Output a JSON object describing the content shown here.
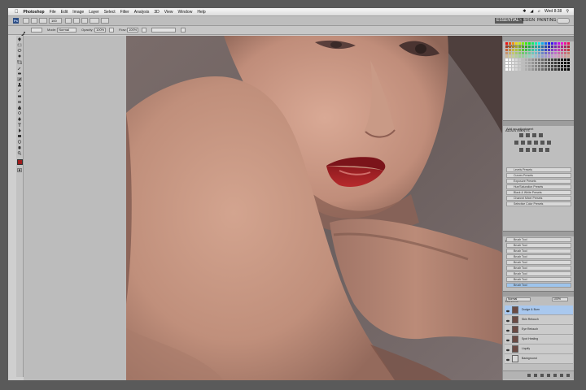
{
  "menubar": {
    "items": [
      "Photoshop",
      "File",
      "Edit",
      "Image",
      "Layer",
      "Select",
      "Filter",
      "Analysis",
      "3D",
      "View",
      "Window",
      "Help"
    ],
    "clock": "Wed 8:38"
  },
  "appbar": {
    "logo": "Ps",
    "zoom": "100",
    "workspaces": [
      "ESSENTIALS",
      "DESIGN",
      "PAINTING"
    ],
    "active_workspace": "ESSENTIALS"
  },
  "options": {
    "mode_label": "Mode:",
    "mode_value": "Normal",
    "opacity_label": "Opacity:",
    "opacity_value": "100%",
    "flow_label": "Flow:",
    "flow_value": "100%"
  },
  "panels": {
    "swatches_tab": "SWATCHES",
    "adjustments_tab": "ADJUSTMENTS",
    "adjustments_title": "Add an adjustment",
    "presets": [
      "Levels Presets",
      "Curves Presets",
      "Exposure Presets",
      "Hue/Saturation Presets",
      "Black & White Presets",
      "Channel Mixer Presets",
      "Selective Color Presets"
    ],
    "history_tab": "HISTORY",
    "history": [
      "Brush Tool",
      "Brush Tool",
      "Brush Tool",
      "Brush Tool",
      "Brush Tool",
      "Brush Tool",
      "Brush Tool",
      "Brush Tool",
      "Brush Tool"
    ],
    "layers_tab": "LAYERS",
    "blend_mode": "Normal",
    "layer_opacity": "100%",
    "layers": [
      "Dodge & Burn",
      "Skin Retouch",
      "Eye Retouch",
      "Spot Healing",
      "Liquify",
      "Background"
    ]
  },
  "colors": {
    "foreground": "#a01c1c",
    "background": "#ffffff",
    "accent": "#a9c8ee"
  }
}
